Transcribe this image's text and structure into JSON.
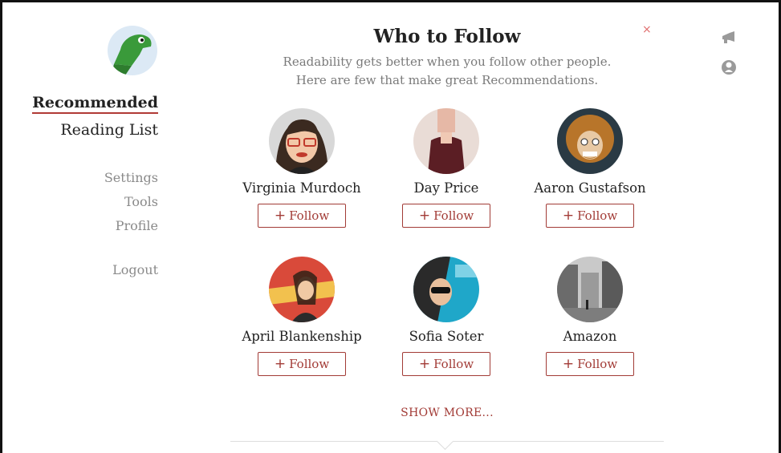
{
  "sidebar": {
    "nav_main": [
      "Recommended",
      "Reading List"
    ],
    "nav_sub": [
      "Settings",
      "Tools",
      "Profile"
    ],
    "logout": "Logout"
  },
  "modal": {
    "title": "Who to Follow",
    "close": "×",
    "subtitle_line1": "Readability gets better when you follow other people.",
    "subtitle_line2": "Here are few that make great Recommendations.",
    "people": [
      {
        "name": "Virginia Murdoch"
      },
      {
        "name": "Day Price"
      },
      {
        "name": "Aaron Gustafson"
      },
      {
        "name": "April Blankenship"
      },
      {
        "name": "Sofia Soter"
      },
      {
        "name": "Amazon"
      }
    ],
    "follow_label": "Follow",
    "follow_plus": "+",
    "show_more": "SHOW MORE..."
  },
  "icons": {
    "logo": "green-dinosaur-logo-icon",
    "right": [
      "megaphone-icon",
      "user-icon"
    ]
  },
  "colors": {
    "accent": "#a23b36",
    "muted_text": "#8a8a8a",
    "logo_bg": "#dce9f5",
    "logo_green": "#3a9a3a"
  }
}
